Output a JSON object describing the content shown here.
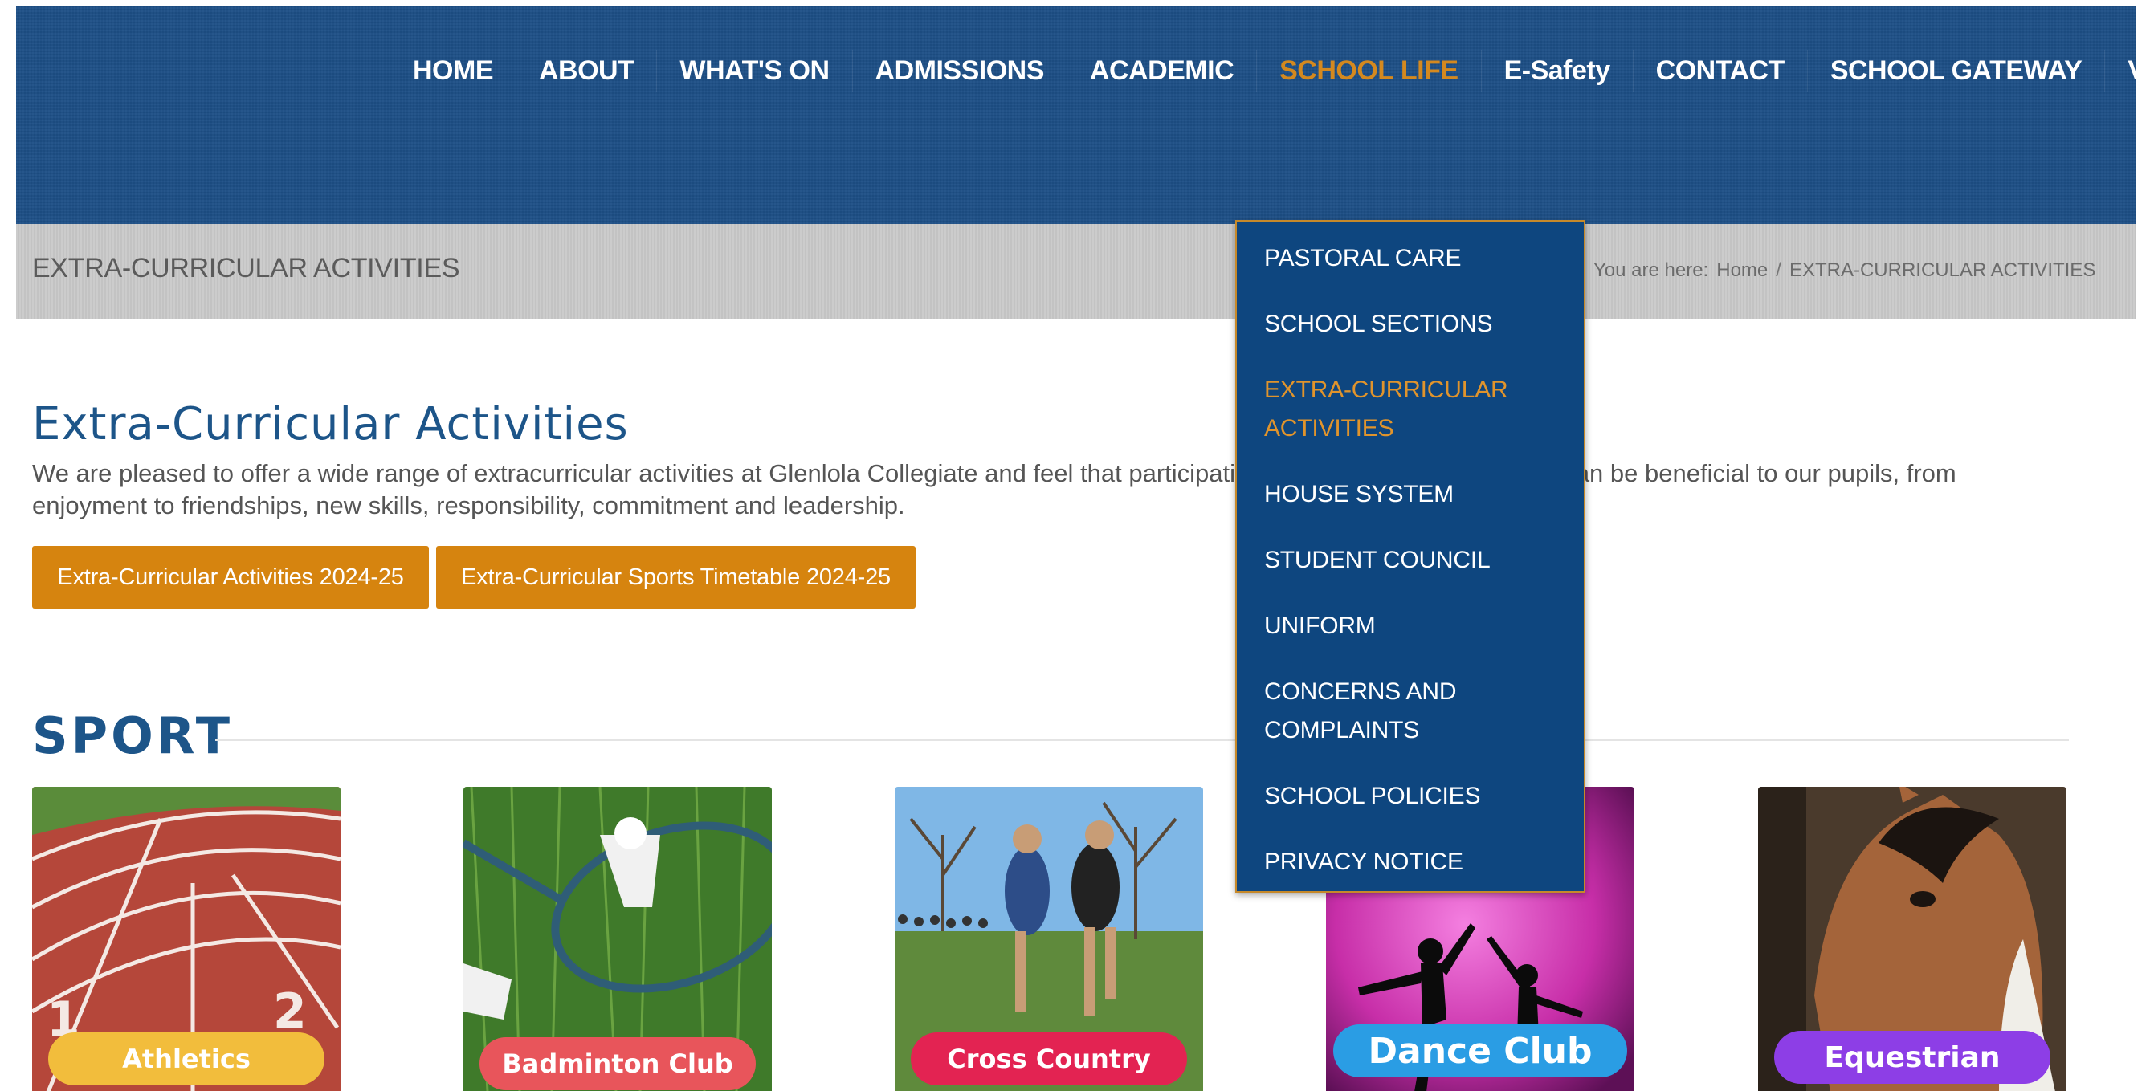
{
  "nav": {
    "items": [
      "HOME",
      "ABOUT",
      "WHAT'S ON",
      "ADMISSIONS",
      "ACADEMIC",
      "SCHOOL LIFE",
      "E-Safety",
      "CONTACT",
      "SCHOOL GATEWAY",
      "VACANCIES"
    ],
    "active": "SCHOOL LIFE"
  },
  "titlebar": {
    "page_title": "EXTRA-CURRICULAR ACTIVITIES",
    "breadcrumb": {
      "prefix": "You are here:",
      "home": "Home",
      "separator": "/",
      "current": "EXTRA-CURRICULAR ACTIVITIES"
    }
  },
  "dropdown": {
    "items": [
      "PASTORAL CARE",
      "SCHOOL SECTIONS",
      "EXTRA-CURRICULAR ACTIVITIES",
      "HOUSE SYSTEM",
      "STUDENT COUNCIL",
      "UNIFORM",
      "CONCERNS AND COMPLAINTS",
      "SCHOOL POLICIES",
      "PRIVACY NOTICE"
    ],
    "active": "EXTRA-CURRICULAR ACTIVITIES"
  },
  "intro": {
    "title": "Extra-Curricular Activities",
    "text_line1": "We are pleased to offer a wide range of extracurricular activities at Glenlola Collegiate and feel that participation in extracurricular activities can be beneficial to our pupils, from",
    "text_line2": "enjoyment to friendships, new skills, responsibility, commitment and leadership."
  },
  "buttons": {
    "activities": "Extra-Curricular Activities 2024-25",
    "timetable": "Extra-Curricular Sports Timetable 2024-25"
  },
  "sport": {
    "heading": "SPORT",
    "cards": [
      {
        "label": "Athletics",
        "label_color": "#f2bd3c"
      },
      {
        "label": "Badminton Club",
        "label_color": "#e8555b"
      },
      {
        "label": "Cross Country",
        "label_color": "#e32352"
      },
      {
        "label": "Dance Club",
        "label_color": "#2a9de4"
      },
      {
        "label": "Equestrian",
        "label_color": "#8d3ee6"
      }
    ]
  },
  "colors": {
    "header_blue": "#1d4f86",
    "dropdown_blue": "#0e467f",
    "accent_orange": "#d6840f",
    "heading_blue": "#1d5589"
  }
}
